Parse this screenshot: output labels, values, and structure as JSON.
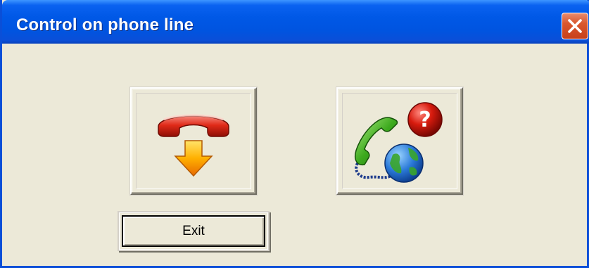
{
  "window": {
    "title": "Control on phone line",
    "close_icon": "close-icon",
    "colors": {
      "titlebar": "#0054E0",
      "body": "#ECE9D8",
      "close": "#D9572E"
    }
  },
  "buttons": {
    "hangup_icon": "hang-up-phone-icon",
    "support_icon": "phone-globe-help-icon",
    "exit_label": "Exit"
  }
}
